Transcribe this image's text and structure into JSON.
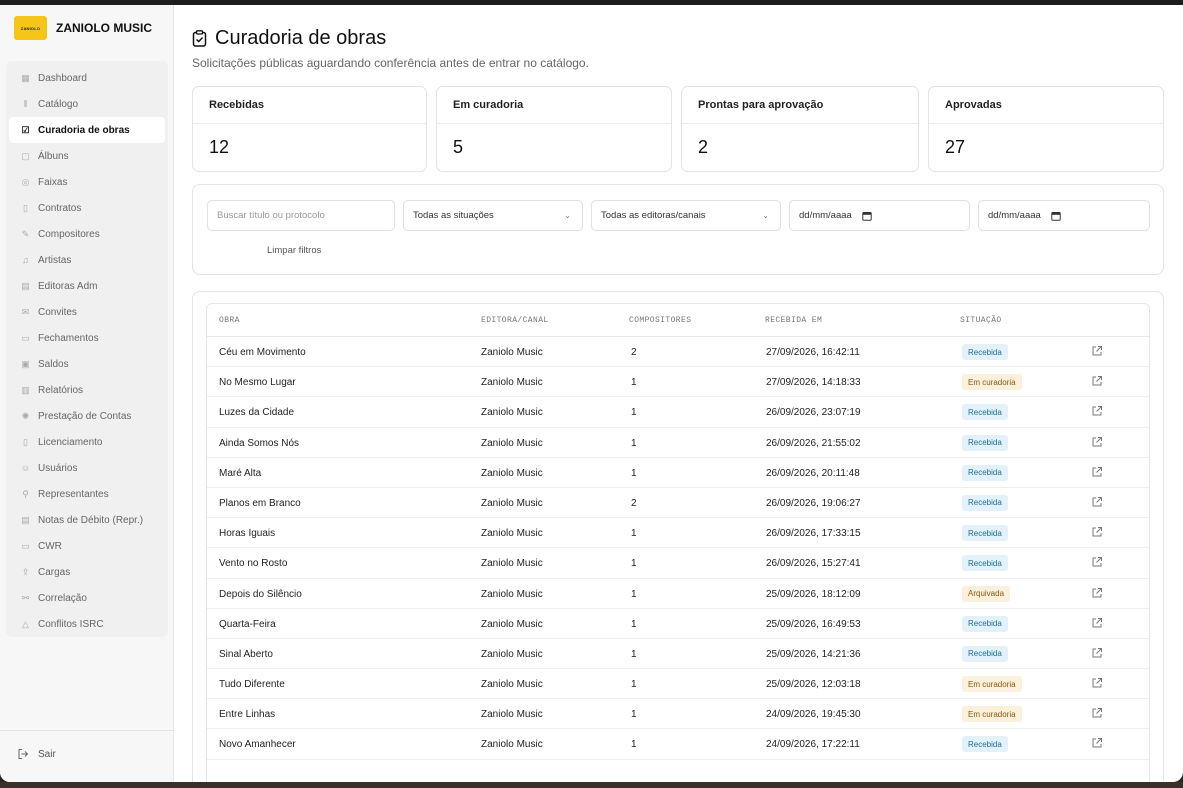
{
  "brand": {
    "logo_text": "ZANIOLO",
    "name": "ZANIOLO MUSIC"
  },
  "sidebar": {
    "items": [
      {
        "label": "Dashboard",
        "icon": "grid-icon",
        "active": false
      },
      {
        "label": "Catálogo",
        "icon": "library-icon",
        "active": false
      },
      {
        "label": "Curadoria de obras",
        "icon": "clipboard-check-icon",
        "active": true
      },
      {
        "label": "Álbuns",
        "icon": "album-icon",
        "active": false
      },
      {
        "label": "Faixas",
        "icon": "disc-icon",
        "active": false
      },
      {
        "label": "Contratos",
        "icon": "file-icon",
        "active": false
      },
      {
        "label": "Compositores",
        "icon": "pen-icon",
        "active": false
      },
      {
        "label": "Artistas",
        "icon": "music-note-icon",
        "active": false
      },
      {
        "label": "Editoras Adm",
        "icon": "building-icon",
        "active": false
      },
      {
        "label": "Convites",
        "icon": "mail-icon",
        "active": false
      },
      {
        "label": "Fechamentos",
        "icon": "inbox-icon",
        "active": false
      },
      {
        "label": "Saldos",
        "icon": "wallet-icon",
        "active": false
      },
      {
        "label": "Relatórios",
        "icon": "report-icon",
        "active": false
      },
      {
        "label": "Prestação de Contas",
        "icon": "badge-icon",
        "active": false
      },
      {
        "label": "Licenciamento",
        "icon": "clipboard-icon",
        "active": false
      },
      {
        "label": "Usuários",
        "icon": "users-icon",
        "active": false
      },
      {
        "label": "Representantes",
        "icon": "user-key-icon",
        "active": false
      },
      {
        "label": "Notas de Débito (Repr.)",
        "icon": "note-icon",
        "active": false
      },
      {
        "label": "CWR",
        "icon": "cwr-icon",
        "active": false
      },
      {
        "label": "Cargas",
        "icon": "upload-icon",
        "active": false
      },
      {
        "label": "Correlação",
        "icon": "link-icon",
        "active": false
      },
      {
        "label": "Conflitos ISRC",
        "icon": "warning-icon",
        "active": false
      }
    ],
    "logout_label": "Sair"
  },
  "page": {
    "title": "Curadoria de obras",
    "subtitle": "Solicitações públicas aguardando conferência antes de entrar no catálogo."
  },
  "stats": [
    {
      "label": "Recebidas",
      "value": "12"
    },
    {
      "label": "Em curadoria",
      "value": "5"
    },
    {
      "label": "Prontas para aprovação",
      "value": "2"
    },
    {
      "label": "Aprovadas",
      "value": "27"
    }
  ],
  "filters": {
    "search_placeholder": "Buscar título ou protocolo",
    "status_value": "Todas as situações",
    "publisher_value": "Todas as editoras/canais",
    "date_from": "dd/mm/aaaa",
    "date_to": "dd/mm/aaaa",
    "clear_label": "Limpar filtros"
  },
  "table": {
    "headers": {
      "obra": "OBRA",
      "editora": "EDITORA/CANAL",
      "compositores": "COMPOSITORES",
      "recebida": "RECEBIDA EM",
      "situacao": "SITUAÇÃO"
    },
    "rows": [
      {
        "obra": "Céu em Movimento",
        "editora": "Zaniolo Music",
        "compositores": "2",
        "recebida": "27/09/2026, 16:42:11",
        "situacao": "Recebida",
        "kind": "rec"
      },
      {
        "obra": "No Mesmo Lugar",
        "editora": "Zaniolo Music",
        "compositores": "1",
        "recebida": "27/09/2026, 14:18:33",
        "situacao": "Em curadoria",
        "kind": "cur"
      },
      {
        "obra": "Luzes da Cidade",
        "editora": "Zaniolo Music",
        "compositores": "1",
        "recebida": "26/09/2026, 23:07:19",
        "situacao": "Recebida",
        "kind": "rec"
      },
      {
        "obra": "Ainda Somos Nós",
        "editora": "Zaniolo Music",
        "compositores": "1",
        "recebida": "26/09/2026, 21:55:02",
        "situacao": "Recebida",
        "kind": "rec"
      },
      {
        "obra": "Maré Alta",
        "editora": "Zaniolo Music",
        "compositores": "1",
        "recebida": "26/09/2026, 20:11:48",
        "situacao": "Recebida",
        "kind": "rec"
      },
      {
        "obra": "Planos em Branco",
        "editora": "Zaniolo Music",
        "compositores": "2",
        "recebida": "26/09/2026, 19:06:27",
        "situacao": "Recebida",
        "kind": "rec"
      },
      {
        "obra": "Horas Iguais",
        "editora": "Zaniolo Music",
        "compositores": "1",
        "recebida": "26/09/2026, 17:33:15",
        "situacao": "Recebida",
        "kind": "rec"
      },
      {
        "obra": "Vento no Rosto",
        "editora": "Zaniolo Music",
        "compositores": "1",
        "recebida": "26/09/2026, 15:27:41",
        "situacao": "Recebida",
        "kind": "rec"
      },
      {
        "obra": "Depois do Silêncio",
        "editora": "Zaniolo Music",
        "compositores": "1",
        "recebida": "25/09/2026, 18:12:09",
        "situacao": "Arquivada",
        "kind": "arq"
      },
      {
        "obra": "Quarta-Feira",
        "editora": "Zaniolo Music",
        "compositores": "1",
        "recebida": "25/09/2026, 16:49:53",
        "situacao": "Recebida",
        "kind": "rec"
      },
      {
        "obra": "Sinal Aberto",
        "editora": "Zaniolo Music",
        "compositores": "1",
        "recebida": "25/09/2026, 14:21:36",
        "situacao": "Recebida",
        "kind": "rec"
      },
      {
        "obra": "Tudo Diferente",
        "editora": "Zaniolo Music",
        "compositores": "1",
        "recebida": "25/09/2026, 12:03:18",
        "situacao": "Em curadoria",
        "kind": "cur"
      },
      {
        "obra": "Entre Linhas",
        "editora": "Zaniolo Music",
        "compositores": "1",
        "recebida": "24/09/2026, 19:45:30",
        "situacao": "Em curadoria",
        "kind": "cur"
      },
      {
        "obra": "Novo Amanhecer",
        "editora": "Zaniolo Music",
        "compositores": "1",
        "recebida": "24/09/2026, 17:22:11",
        "situacao": "Recebida",
        "kind": "rec"
      }
    ]
  },
  "colors": {
    "brand_yellow": "#f5c518",
    "badge_received_bg": "#e3f2fa",
    "badge_curation_bg": "#fbf0db"
  }
}
